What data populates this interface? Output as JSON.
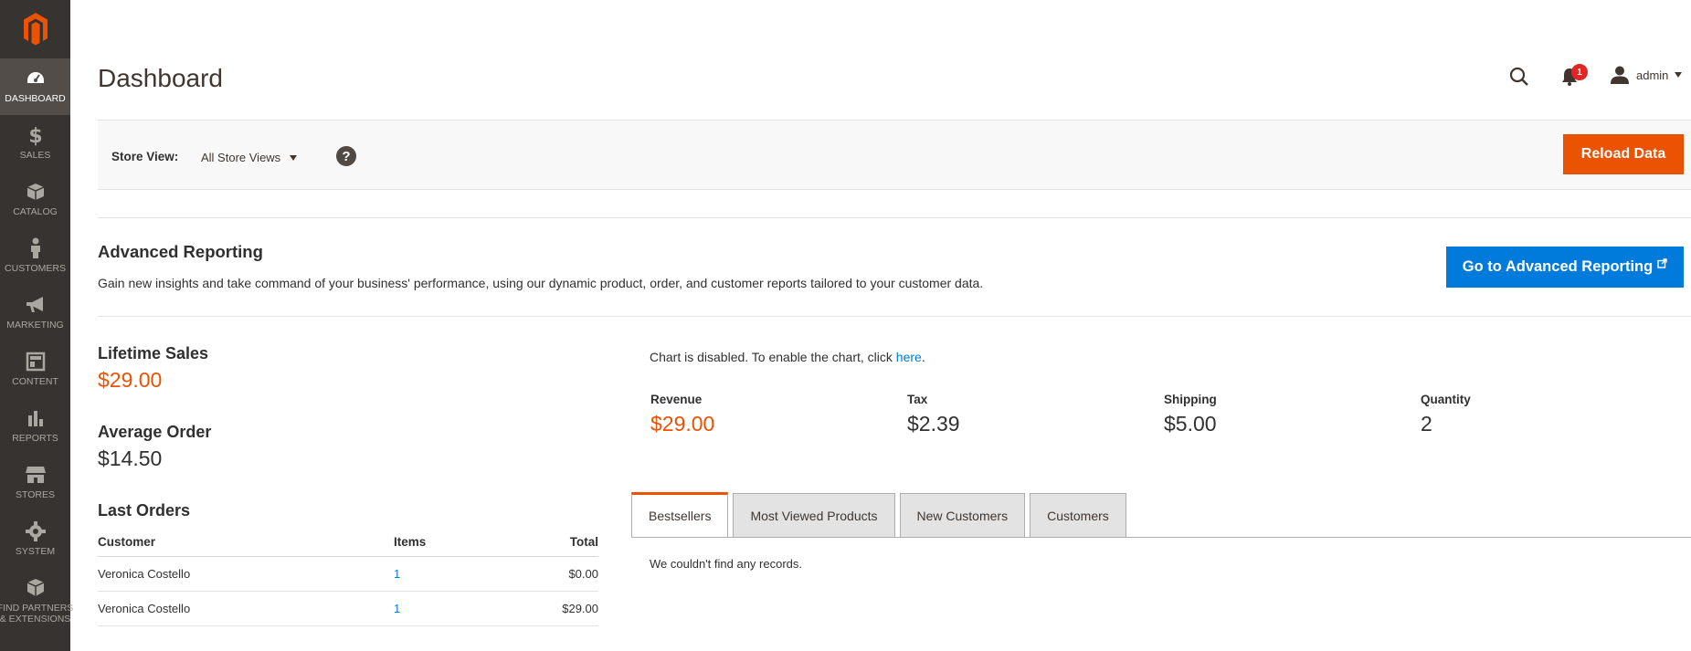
{
  "colors": {
    "accent": "#eb5202",
    "primary": "#007bdb",
    "sidebar": "#373330"
  },
  "sidebar": {
    "items": [
      {
        "label": "DASHBOARD",
        "icon": "speedometer-icon"
      },
      {
        "label": "SALES",
        "icon": "dollar-icon"
      },
      {
        "label": "CATALOG",
        "icon": "box-icon"
      },
      {
        "label": "CUSTOMERS",
        "icon": "person-icon"
      },
      {
        "label": "MARKETING",
        "icon": "megaphone-icon"
      },
      {
        "label": "CONTENT",
        "icon": "layout-icon"
      },
      {
        "label": "REPORTS",
        "icon": "bar-chart-icon"
      },
      {
        "label": "STORES",
        "icon": "storefront-icon"
      },
      {
        "label": "SYSTEM",
        "icon": "gear-icon"
      },
      {
        "label1": "FIND PARTNERS",
        "label2": "& EXTENSIONS",
        "icon": "cubes-icon"
      }
    ]
  },
  "header": {
    "title": "Dashboard",
    "notification_count": "1",
    "user": "admin"
  },
  "store_bar": {
    "label": "Store View:",
    "selected": "All Store Views",
    "help": "?",
    "reload_label": "Reload Data"
  },
  "advanced": {
    "title": "Advanced Reporting",
    "description": "Gain new insights and take command of your business' performance, using our dynamic product, order, and customer reports tailored to your customer data.",
    "button_label": "Go to Advanced Reporting"
  },
  "stats": {
    "lifetime_label": "Lifetime Sales",
    "lifetime_value": "$29.00",
    "average_label": "Average Order",
    "average_value": "$14.50"
  },
  "last_orders": {
    "title": "Last Orders",
    "headers": [
      "Customer",
      "Items",
      "Total"
    ],
    "rows": [
      {
        "customer": "Veronica Costello",
        "items": "1",
        "total": "$0.00"
      },
      {
        "customer": "Veronica Costello",
        "items": "1",
        "total": "$29.00"
      }
    ]
  },
  "chart": {
    "message": "Chart is disabled. To enable the chart, click ",
    "link": "here",
    "suffix": "."
  },
  "totals": {
    "revenue_label": "Revenue",
    "revenue_value": "$29.00",
    "tax_label": "Tax",
    "tax_value": "$2.39",
    "shipping_label": "Shipping",
    "shipping_value": "$5.00",
    "quantity_label": "Quantity",
    "quantity_value": "2"
  },
  "tabs": {
    "items": [
      "Bestsellers",
      "Most Viewed Products",
      "New Customers",
      "Customers"
    ],
    "empty_message": "We couldn't find any records."
  }
}
